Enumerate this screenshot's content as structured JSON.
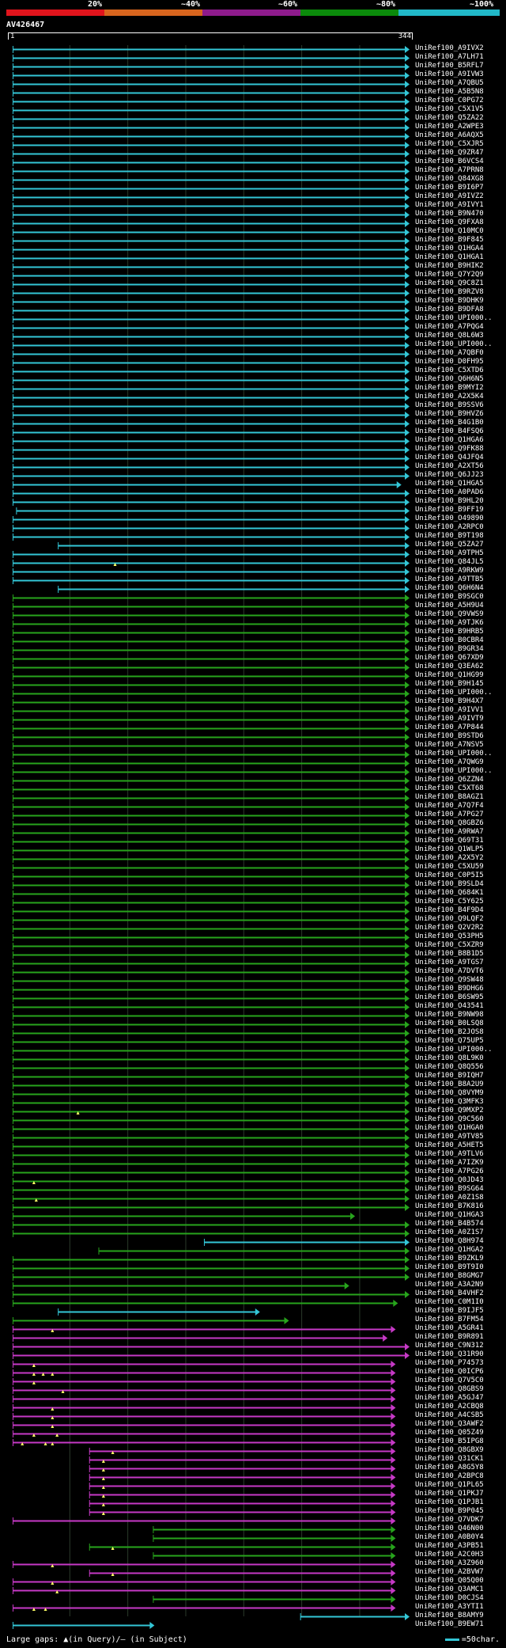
{
  "legend": {
    "segments": [
      {
        "color": "#e0141c"
      },
      {
        "color": "#d8651e"
      },
      {
        "color": "#8e1b8c"
      },
      {
        "color": "#0b8a0b"
      },
      {
        "color": "#21b8c8"
      }
    ],
    "labels": [
      "20%",
      "~40%",
      "~60%",
      "~80%",
      "~100%"
    ]
  },
  "query": {
    "id": "AV426467",
    "start": "1",
    "end": "344"
  },
  "colors": {
    "cyan": "#33c6d6",
    "green": "#27a41c",
    "magenta": "#c639c6",
    "gap": "#ffff66"
  },
  "hits": [
    {
      "id": "UniRef100_A9IVX2",
      "c": "cyan",
      "s": 2,
      "e": 344
    },
    {
      "id": "UniRef100_A7LH71",
      "c": "cyan",
      "s": 2,
      "e": 344
    },
    {
      "id": "UniRef100_B5RFL7",
      "c": "cyan",
      "s": 2,
      "e": 344
    },
    {
      "id": "UniRef100_A9IVW3",
      "c": "cyan",
      "s": 2,
      "e": 344
    },
    {
      "id": "UniRef100_A7QBU5",
      "c": "cyan",
      "s": 2,
      "e": 344
    },
    {
      "id": "UniRef100_A5B5N8",
      "c": "cyan",
      "s": 2,
      "e": 344
    },
    {
      "id": "UniRef100_C0PG72",
      "c": "cyan",
      "s": 2,
      "e": 344
    },
    {
      "id": "UniRef100_C5X1V5",
      "c": "cyan",
      "s": 2,
      "e": 344
    },
    {
      "id": "UniRef100_Q5ZA22",
      "c": "cyan",
      "s": 2,
      "e": 344
    },
    {
      "id": "UniRef100_A2WPE3",
      "c": "cyan",
      "s": 2,
      "e": 344
    },
    {
      "id": "UniRef100_A6AQX5",
      "c": "cyan",
      "s": 2,
      "e": 344
    },
    {
      "id": "UniRef100_C5XJR5",
      "c": "cyan",
      "s": 2,
      "e": 344
    },
    {
      "id": "UniRef100_Q9ZR47",
      "c": "cyan",
      "s": 2,
      "e": 344
    },
    {
      "id": "UniRef100_B6VCS4",
      "c": "cyan",
      "s": 2,
      "e": 344
    },
    {
      "id": "UniRef100_A7PRN8",
      "c": "cyan",
      "s": 2,
      "e": 344
    },
    {
      "id": "UniRef100_Q84XG8",
      "c": "cyan",
      "s": 2,
      "e": 344
    },
    {
      "id": "UniRef100_B9I6P7",
      "c": "cyan",
      "s": 2,
      "e": 344
    },
    {
      "id": "UniRef100_A9IVZ2",
      "c": "cyan",
      "s": 2,
      "e": 344
    },
    {
      "id": "UniRef100_A9IVY1",
      "c": "cyan",
      "s": 2,
      "e": 344
    },
    {
      "id": "UniRef100_B9N470",
      "c": "cyan",
      "s": 2,
      "e": 344
    },
    {
      "id": "UniRef100_Q9FXA8",
      "c": "cyan",
      "s": 2,
      "e": 344
    },
    {
      "id": "UniRef100_Q10MC0",
      "c": "cyan",
      "s": 2,
      "e": 344
    },
    {
      "id": "UniRef100_B9F845",
      "c": "cyan",
      "s": 2,
      "e": 344
    },
    {
      "id": "UniRef100_Q1HGA4",
      "c": "cyan",
      "s": 2,
      "e": 344
    },
    {
      "id": "UniRef100_Q1HGA1",
      "c": "cyan",
      "s": 2,
      "e": 344
    },
    {
      "id": "UniRef100_B9HIK2",
      "c": "cyan",
      "s": 2,
      "e": 344
    },
    {
      "id": "UniRef100_Q7Y2Q9",
      "c": "cyan",
      "s": 2,
      "e": 344
    },
    {
      "id": "UniRef100_Q9C8Z1",
      "c": "cyan",
      "s": 2,
      "e": 344
    },
    {
      "id": "UniRef100_B9RZV8",
      "c": "cyan",
      "s": 2,
      "e": 344
    },
    {
      "id": "UniRef100_B9DHK9",
      "c": "cyan",
      "s": 2,
      "e": 344
    },
    {
      "id": "UniRef100_B9DFA8",
      "c": "cyan",
      "s": 2,
      "e": 344
    },
    {
      "id": "UniRef100_UPI000..",
      "c": "cyan",
      "s": 2,
      "e": 344
    },
    {
      "id": "UniRef100_A7PQG4",
      "c": "cyan",
      "s": 2,
      "e": 344
    },
    {
      "id": "UniRef100_Q8L6W3",
      "c": "cyan",
      "s": 2,
      "e": 344
    },
    {
      "id": "UniRef100_UPI000..",
      "c": "cyan",
      "s": 2,
      "e": 344
    },
    {
      "id": "UniRef100_A7QBF0",
      "c": "cyan",
      "s": 2,
      "e": 344
    },
    {
      "id": "UniRef100_D0FH95",
      "c": "cyan",
      "s": 2,
      "e": 344
    },
    {
      "id": "UniRef100_C5XTD6",
      "c": "cyan",
      "s": 2,
      "e": 344
    },
    {
      "id": "UniRef100_Q6H6N5",
      "c": "cyan",
      "s": 2,
      "e": 344
    },
    {
      "id": "UniRef100_B9MYI2",
      "c": "cyan",
      "s": 2,
      "e": 344
    },
    {
      "id": "UniRef100_A2X5K4",
      "c": "cyan",
      "s": 2,
      "e": 344
    },
    {
      "id": "UniRef100_B9SSV6",
      "c": "cyan",
      "s": 2,
      "e": 344
    },
    {
      "id": "UniRef100_B9HVZ6",
      "c": "cyan",
      "s": 2,
      "e": 344
    },
    {
      "id": "UniRef100_B4G1B0",
      "c": "cyan",
      "s": 2,
      "e": 344
    },
    {
      "id": "UniRef100_B4FSQ6",
      "c": "cyan",
      "s": 2,
      "e": 344
    },
    {
      "id": "UniRef100_Q1HGA6",
      "c": "cyan",
      "s": 2,
      "e": 344
    },
    {
      "id": "UniRef100_Q9FK88",
      "c": "cyan",
      "s": 2,
      "e": 344
    },
    {
      "id": "UniRef100_Q4JFQ4",
      "c": "cyan",
      "s": 2,
      "e": 344
    },
    {
      "id": "UniRef100_A2XT56",
      "c": "cyan",
      "s": 2,
      "e": 344
    },
    {
      "id": "UniRef100_Q6JJ23",
      "c": "cyan",
      "s": 2,
      "e": 344
    },
    {
      "id": "UniRef100_Q1HGA5",
      "c": "cyan",
      "s": 2,
      "e": 337
    },
    {
      "id": "UniRef100_A0PAD6",
      "c": "cyan",
      "s": 2,
      "e": 344
    },
    {
      "id": "UniRef100_B9HL20",
      "c": "cyan",
      "s": 2,
      "e": 344
    },
    {
      "id": "UniRef100_B9FF19",
      "c": "cyan",
      "s": 5,
      "e": 344
    },
    {
      "id": "UniRef100_O49890",
      "c": "cyan",
      "s": 2,
      "e": 344
    },
    {
      "id": "UniRef100_A2RPC0",
      "c": "cyan",
      "s": 2,
      "e": 344
    },
    {
      "id": "UniRef100_B9T198",
      "c": "cyan",
      "s": 2,
      "e": 344
    },
    {
      "id": "UniRef100_Q5ZA27",
      "c": "cyan",
      "s": 41,
      "e": 344
    },
    {
      "id": "UniRef100_A9TPH5",
      "c": "cyan",
      "s": 2,
      "e": 344
    },
    {
      "id": "UniRef100_Q84JL5",
      "c": "cyan",
      "s": 2,
      "e": 344,
      "g": [
        90
      ]
    },
    {
      "id": "UniRef100_A9RKW9",
      "c": "cyan",
      "s": 2,
      "e": 344
    },
    {
      "id": "UniRef100_A9TTB5",
      "c": "cyan",
      "s": 2,
      "e": 344
    },
    {
      "id": "UniRef100_Q6H6N4",
      "c": "cyan",
      "s": 41,
      "e": 344
    },
    {
      "id": "UniRef100_B9SGC0",
      "c": "green",
      "s": 2,
      "e": 344
    },
    {
      "id": "UniRef100_A5H9U4",
      "c": "green",
      "s": 2,
      "e": 344
    },
    {
      "id": "UniRef100_Q9VWS9",
      "c": "green",
      "s": 2,
      "e": 344
    },
    {
      "id": "UniRef100_A9TJK6",
      "c": "green",
      "s": 2,
      "e": 344
    },
    {
      "id": "UniRef100_B9HRB5",
      "c": "green",
      "s": 2,
      "e": 344
    },
    {
      "id": "UniRef100_B0CBR4",
      "c": "green",
      "s": 2,
      "e": 344
    },
    {
      "id": "UniRef100_B9GR34",
      "c": "green",
      "s": 2,
      "e": 344
    },
    {
      "id": "UniRef100_Q67XD9",
      "c": "green",
      "s": 2,
      "e": 344
    },
    {
      "id": "UniRef100_Q3EA62",
      "c": "green",
      "s": 2,
      "e": 344
    },
    {
      "id": "UniRef100_Q1HG99",
      "c": "green",
      "s": 2,
      "e": 344
    },
    {
      "id": "UniRef100_B9H145",
      "c": "green",
      "s": 2,
      "e": 344
    },
    {
      "id": "UniRef100_UPI000..",
      "c": "green",
      "s": 2,
      "e": 344
    },
    {
      "id": "UniRef100_B9H4X7",
      "c": "green",
      "s": 2,
      "e": 344
    },
    {
      "id": "UniRef100_A9IVV1",
      "c": "green",
      "s": 2,
      "e": 344
    },
    {
      "id": "UniRef100_A9IVT9",
      "c": "green",
      "s": 2,
      "e": 344
    },
    {
      "id": "UniRef100_A7P844",
      "c": "green",
      "s": 2,
      "e": 344
    },
    {
      "id": "UniRef100_B9STD6",
      "c": "green",
      "s": 2,
      "e": 344
    },
    {
      "id": "UniRef100_A7NSV5",
      "c": "green",
      "s": 2,
      "e": 344
    },
    {
      "id": "UniRef100_UPI000..",
      "c": "green",
      "s": 2,
      "e": 344
    },
    {
      "id": "UniRef100_A7QWG9",
      "c": "green",
      "s": 2,
      "e": 344
    },
    {
      "id": "UniRef100_UPI000..",
      "c": "green",
      "s": 2,
      "e": 344
    },
    {
      "id": "UniRef100_Q6ZZN4",
      "c": "green",
      "s": 2,
      "e": 344
    },
    {
      "id": "UniRef100_C5XT68",
      "c": "green",
      "s": 2,
      "e": 344
    },
    {
      "id": "UniRef100_B8AGZ1",
      "c": "green",
      "s": 2,
      "e": 344
    },
    {
      "id": "UniRef100_A7Q7F4",
      "c": "green",
      "s": 2,
      "e": 344
    },
    {
      "id": "UniRef100_A7PG27",
      "c": "green",
      "s": 2,
      "e": 344
    },
    {
      "id": "UniRef100_Q8GBZ6",
      "c": "green",
      "s": 2,
      "e": 344
    },
    {
      "id": "UniRef100_A9RWA7",
      "c": "green",
      "s": 2,
      "e": 344
    },
    {
      "id": "UniRef100_Q69T31",
      "c": "green",
      "s": 2,
      "e": 344
    },
    {
      "id": "UniRef100_Q1WLP5",
      "c": "green",
      "s": 2,
      "e": 344
    },
    {
      "id": "UniRef100_A2X5Y2",
      "c": "green",
      "s": 2,
      "e": 344
    },
    {
      "id": "UniRef100_C5XU59",
      "c": "green",
      "s": 2,
      "e": 344
    },
    {
      "id": "UniRef100_C0P5I5",
      "c": "green",
      "s": 2,
      "e": 344
    },
    {
      "id": "UniRef100_B9SLD4",
      "c": "green",
      "s": 2,
      "e": 344
    },
    {
      "id": "UniRef100_Q684K1",
      "c": "green",
      "s": 2,
      "e": 344
    },
    {
      "id": "UniRef100_C5Y625",
      "c": "green",
      "s": 2,
      "e": 344
    },
    {
      "id": "UniRef100_B4F9D4",
      "c": "green",
      "s": 2,
      "e": 344
    },
    {
      "id": "UniRef100_Q9LQF2",
      "c": "green",
      "s": 2,
      "e": 344
    },
    {
      "id": "UniRef100_Q2V2R2",
      "c": "green",
      "s": 2,
      "e": 344
    },
    {
      "id": "UniRef100_Q53PH5",
      "c": "green",
      "s": 2,
      "e": 344
    },
    {
      "id": "UniRef100_C5XZR9",
      "c": "green",
      "s": 2,
      "e": 344
    },
    {
      "id": "UniRef100_B8B1D5",
      "c": "green",
      "s": 2,
      "e": 344
    },
    {
      "id": "UniRef100_A9TGS7",
      "c": "green",
      "s": 2,
      "e": 344
    },
    {
      "id": "UniRef100_A7DVT6",
      "c": "green",
      "s": 2,
      "e": 344
    },
    {
      "id": "UniRef100_Q9SW48",
      "c": "green",
      "s": 2,
      "e": 344
    },
    {
      "id": "UniRef100_B9DHG6",
      "c": "green",
      "s": 2,
      "e": 344
    },
    {
      "id": "UniRef100_B6SW95",
      "c": "green",
      "s": 2,
      "e": 344
    },
    {
      "id": "UniRef100_O43541",
      "c": "green",
      "s": 2,
      "e": 344
    },
    {
      "id": "UniRef100_B9NW98",
      "c": "green",
      "s": 2,
      "e": 344
    },
    {
      "id": "UniRef100_B0LSQ8",
      "c": "green",
      "s": 2,
      "e": 344
    },
    {
      "id": "UniRef100_B2JOS8",
      "c": "green",
      "s": 2,
      "e": 344
    },
    {
      "id": "UniRef100_Q75UP5",
      "c": "green",
      "s": 2,
      "e": 344
    },
    {
      "id": "UniRef100_UPI000..",
      "c": "green",
      "s": 2,
      "e": 344
    },
    {
      "id": "UniRef100_Q8L9K0",
      "c": "green",
      "s": 2,
      "e": 344
    },
    {
      "id": "UniRef100_Q8Q556",
      "c": "green",
      "s": 2,
      "e": 344
    },
    {
      "id": "UniRef100_B9IQH7",
      "c": "green",
      "s": 2,
      "e": 344
    },
    {
      "id": "UniRef100_B8A2U9",
      "c": "green",
      "s": 2,
      "e": 344
    },
    {
      "id": "UniRef100_Q8VYM9",
      "c": "green",
      "s": 2,
      "e": 344
    },
    {
      "id": "UniRef100_Q3MFK3",
      "c": "green",
      "s": 2,
      "e": 344
    },
    {
      "id": "UniRef100_Q9MXP2",
      "c": "green",
      "s": 2,
      "e": 344,
      "g": [
        58
      ]
    },
    {
      "id": "UniRef100_Q9C560",
      "c": "green",
      "s": 2,
      "e": 344
    },
    {
      "id": "UniRef100_Q1HGA0",
      "c": "green",
      "s": 2,
      "e": 344
    },
    {
      "id": "UniRef100_A9TV85",
      "c": "green",
      "s": 2,
      "e": 344
    },
    {
      "id": "UniRef100_A5HET5",
      "c": "green",
      "s": 2,
      "e": 344
    },
    {
      "id": "UniRef100_A9TLV6",
      "c": "green",
      "s": 2,
      "e": 344
    },
    {
      "id": "UniRef100_A7IZK9",
      "c": "green",
      "s": 2,
      "e": 344
    },
    {
      "id": "UniRef100_A7PG26",
      "c": "green",
      "s": 2,
      "e": 344
    },
    {
      "id": "UniRef100_Q0JD43",
      "c": "green",
      "s": 2,
      "e": 344,
      "g": [
        20
      ]
    },
    {
      "id": "UniRef100_B9SG64",
      "c": "green",
      "s": 2,
      "e": 344
    },
    {
      "id": "UniRef100_A0Z1S8",
      "c": "green",
      "s": 2,
      "e": 344,
      "g": [
        22
      ]
    },
    {
      "id": "UniRef100_B7K816",
      "c": "green",
      "s": 2,
      "e": 344
    },
    {
      "id": "UniRef100_Q1HGA3",
      "c": "green",
      "s": 2,
      "e": 297
    },
    {
      "id": "UniRef100_B4B574",
      "c": "green",
      "s": 2,
      "e": 344
    },
    {
      "id": "UniRef100_A0Z1S7",
      "c": "green",
      "s": 2,
      "e": 344
    },
    {
      "id": "UniRef100_Q8H974",
      "c": "cyan",
      "s": 167,
      "e": 344
    },
    {
      "id": "UniRef100_Q1HGA2",
      "c": "green",
      "s": 76,
      "e": 344
    },
    {
      "id": "UniRef100_B9ZKL9",
      "c": "green",
      "s": 2,
      "e": 344
    },
    {
      "id": "UniRef100_B9T9I0",
      "c": "green",
      "s": 2,
      "e": 344
    },
    {
      "id": "UniRef100_B8GMG7",
      "c": "green",
      "s": 2,
      "e": 344
    },
    {
      "id": "UniRef100_A3A2N9",
      "c": "green",
      "s": 2,
      "e": 292
    },
    {
      "id": "UniRef100_B4VHF2",
      "c": "green",
      "s": 2,
      "e": 344
    },
    {
      "id": "UniRef100_C0M1I0",
      "c": "green",
      "s": 2,
      "e": 334
    },
    {
      "id": "UniRef100_B9IJF5",
      "c": "cyan",
      "s": 41,
      "e": 215
    },
    {
      "id": "UniRef100_B7FM54",
      "c": "green",
      "s": 2,
      "e": 240
    },
    {
      "id": "UniRef100_A5GR41",
      "c": "magenta",
      "s": 2,
      "e": 332,
      "g": [
        36
      ]
    },
    {
      "id": "UniRef100_B9R891",
      "c": "magenta",
      "s": 2,
      "e": 325
    },
    {
      "id": "UniRef100_C9N312",
      "c": "magenta",
      "s": 2,
      "e": 344
    },
    {
      "id": "UniRef100_Q31R90",
      "c": "magenta",
      "s": 2,
      "e": 344
    },
    {
      "id": "UniRef100_P74573",
      "c": "magenta",
      "s": 2,
      "e": 332,
      "g": [
        20
      ]
    },
    {
      "id": "UniRef100_Q0ICP6",
      "c": "magenta",
      "s": 2,
      "e": 332,
      "g": [
        20,
        28,
        36
      ]
    },
    {
      "id": "UniRef100_Q7V5C0",
      "c": "magenta",
      "s": 2,
      "e": 332,
      "g": [
        20
      ]
    },
    {
      "id": "UniRef100_Q8GBS9",
      "c": "magenta",
      "s": 2,
      "e": 332,
      "g": [
        45
      ]
    },
    {
      "id": "UniRef100_A5GJ47",
      "c": "magenta",
      "s": 2,
      "e": 332
    },
    {
      "id": "UniRef100_A2CBQ8",
      "c": "magenta",
      "s": 2,
      "e": 332,
      "g": [
        36
      ]
    },
    {
      "id": "UniRef100_A4CSB5",
      "c": "magenta",
      "s": 2,
      "e": 332,
      "g": [
        36
      ]
    },
    {
      "id": "UniRef100_Q3AWF2",
      "c": "magenta",
      "s": 2,
      "e": 332,
      "g": [
        36
      ]
    },
    {
      "id": "UniRef100_Q05Z49",
      "c": "magenta",
      "s": 2,
      "e": 332,
      "g": [
        20,
        40
      ]
    },
    {
      "id": "UniRef100_B5IPG8",
      "c": "magenta",
      "s": 2,
      "e": 332,
      "g": [
        10,
        30,
        36
      ]
    },
    {
      "id": "UniRef100_Q8GBX9",
      "c": "magenta",
      "s": 68,
      "e": 332,
      "g": [
        88
      ]
    },
    {
      "id": "UniRef100_Q31CK1",
      "c": "magenta",
      "s": 68,
      "e": 332,
      "g": [
        80
      ]
    },
    {
      "id": "UniRef100_A8G5Y8",
      "c": "magenta",
      "s": 68,
      "e": 332,
      "g": [
        80
      ]
    },
    {
      "id": "UniRef100_A2BPC8",
      "c": "magenta",
      "s": 68,
      "e": 332,
      "g": [
        80
      ]
    },
    {
      "id": "UniRef100_Q1PL65",
      "c": "magenta",
      "s": 68,
      "e": 332,
      "g": [
        80
      ]
    },
    {
      "id": "UniRef100_Q1PKJ7",
      "c": "magenta",
      "s": 68,
      "e": 332,
      "g": [
        80
      ]
    },
    {
      "id": "UniRef100_Q1PJB1",
      "c": "magenta",
      "s": 68,
      "e": 332,
      "g": [
        80
      ]
    },
    {
      "id": "UniRef100_B9P045",
      "c": "magenta",
      "s": 68,
      "e": 332,
      "g": [
        80
      ]
    },
    {
      "id": "UniRef100_Q7VDK7",
      "c": "magenta",
      "s": 2,
      "e": 332
    },
    {
      "id": "UniRef100_Q46N00",
      "c": "green",
      "s": 123,
      "e": 332
    },
    {
      "id": "UniRef100_A0B0Y4",
      "c": "green",
      "s": 123,
      "e": 332
    },
    {
      "id": "UniRef100_A3PB51",
      "c": "green",
      "s": 68,
      "e": 332,
      "g": [
        88
      ]
    },
    {
      "id": "UniRef100_A2C0H3",
      "c": "green",
      "s": 123,
      "e": 332
    },
    {
      "id": "UniRef100_A3Z960",
      "c": "magenta",
      "s": 2,
      "e": 332,
      "g": [
        36
      ]
    },
    {
      "id": "UniRef100_A2BVW7",
      "c": "magenta",
      "s": 68,
      "e": 332,
      "g": [
        88
      ]
    },
    {
      "id": "UniRef100_Q05Q00",
      "c": "magenta",
      "s": 2,
      "e": 332,
      "g": [
        36
      ]
    },
    {
      "id": "UniRef100_Q3AMC1",
      "c": "magenta",
      "s": 2,
      "e": 332,
      "g": [
        40
      ]
    },
    {
      "id": "UniRef100_D0CJS4",
      "c": "green",
      "s": 123,
      "e": 332
    },
    {
      "id": "UniRef100_A3YTI1",
      "c": "magenta",
      "s": 2,
      "e": 332,
      "g": [
        20,
        30
      ]
    },
    {
      "id": "UniRef100_B8AMY9",
      "c": "cyan",
      "s": 250,
      "e": 344
    },
    {
      "id": "UniRef100_B9EW71",
      "c": "cyan",
      "s": 2,
      "e": 124
    }
  ],
  "footer": {
    "gaps_text": "Large gaps: ▲(in Query)/— (in Subject)",
    "scale_text": "=50char."
  }
}
